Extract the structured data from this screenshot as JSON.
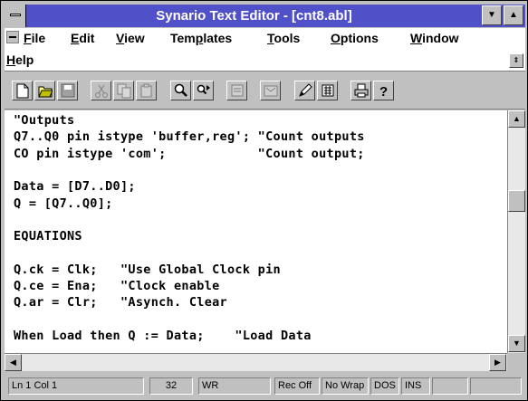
{
  "window": {
    "title": "Synario Text Editor - [cnt8.abl]",
    "minimize_glyph": "▼",
    "maximize_glyph": "▲"
  },
  "menu": {
    "items": [
      {
        "label": "File",
        "accel": "F"
      },
      {
        "label": "Edit",
        "accel": "E"
      },
      {
        "label": "View",
        "accel": "V"
      },
      {
        "label": "Templates",
        "accel": "p"
      },
      {
        "label": "Tools",
        "accel": "T"
      },
      {
        "label": "Options",
        "accel": "O"
      },
      {
        "label": "Window",
        "accel": "W"
      },
      {
        "label": "Help",
        "accel": "H"
      }
    ],
    "restore_glyph": "⇕"
  },
  "toolbar": {
    "buttons": [
      "new-document-icon",
      "open-folder-icon",
      "save-disk-icon",
      "cut-scissors-icon",
      "copy-icon",
      "paste-icon",
      "find-magnifier-icon",
      "find-next-icon",
      "replace-icon",
      "template-icon",
      "pencil-tool-icon",
      "compile-icon",
      "print-icon",
      "help-question-icon"
    ]
  },
  "editor": {
    "lines": [
      "\"Outputs",
      "Q7..Q0 pin istype 'buffer,reg'; \"Count outputs",
      "CO pin istype 'com';            \"Count output;",
      "",
      "Data = [D7..D0];",
      "Q = [Q7..Q0];",
      "",
      "EQUATIONS",
      "",
      "Q.ck = Clk;   \"Use Global Clock pin",
      "Q.ce = Ena;   \"Clock enable",
      "Q.ar = Clr;   \"Asynch. Clear",
      "",
      "When Load then Q := Data;    \"Load Data"
    ]
  },
  "scroll": {
    "up_glyph": "▲",
    "down_glyph": "▼",
    "left_glyph": "◀",
    "right_glyph": "▶"
  },
  "status": {
    "position": "Ln 1 Col 1",
    "value": "32",
    "mode": "WR",
    "record": "Rec Off",
    "wrap": "No Wrap",
    "format": "DOS",
    "insert": "INS"
  }
}
